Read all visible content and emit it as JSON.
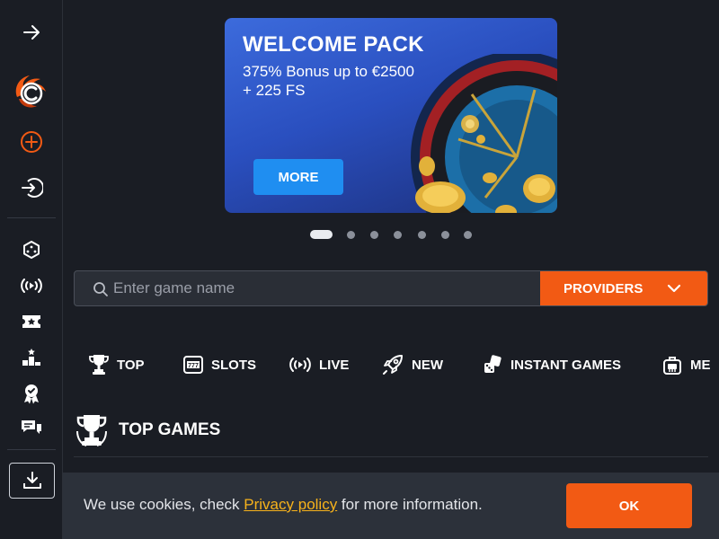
{
  "sidebar": {
    "icons": [
      "arrow-right-icon",
      "logo",
      "plus-circle-icon",
      "login-icon",
      "dice-icon",
      "live-icon",
      "ticket-icon",
      "podium-icon",
      "award-icon",
      "chat-icon",
      "download-icon"
    ]
  },
  "banner": {
    "title": "WELCOME PACK",
    "subtitle": "375% Bonus up to €2500 + 225 FS",
    "button": "MORE",
    "slides": 7,
    "active_slide": 1
  },
  "search": {
    "placeholder": "Enter game name",
    "providers_label": "PROVIDERS"
  },
  "categories": [
    {
      "label": "TOP",
      "icon": "trophy-icon"
    },
    {
      "label": "SLOTS",
      "icon": "slot-machine-icon"
    },
    {
      "label": "LIVE",
      "icon": "live-icon"
    },
    {
      "label": "NEW",
      "icon": "rocket-icon"
    },
    {
      "label": "INSTANT GAMES",
      "icon": "dice-icon"
    },
    {
      "label": "ME",
      "icon": "robot-icon"
    }
  ],
  "top_games": {
    "title": "TOP GAMES"
  },
  "cookie": {
    "text_before": "We use cookies, check ",
    "link": "Privacy policy",
    "text_after": " for more information.",
    "ok": "OK"
  },
  "colors": {
    "background": "#1a1d24",
    "accent": "#f25a14",
    "banner_button": "#1f8ef1",
    "link": "#f7b21b"
  }
}
